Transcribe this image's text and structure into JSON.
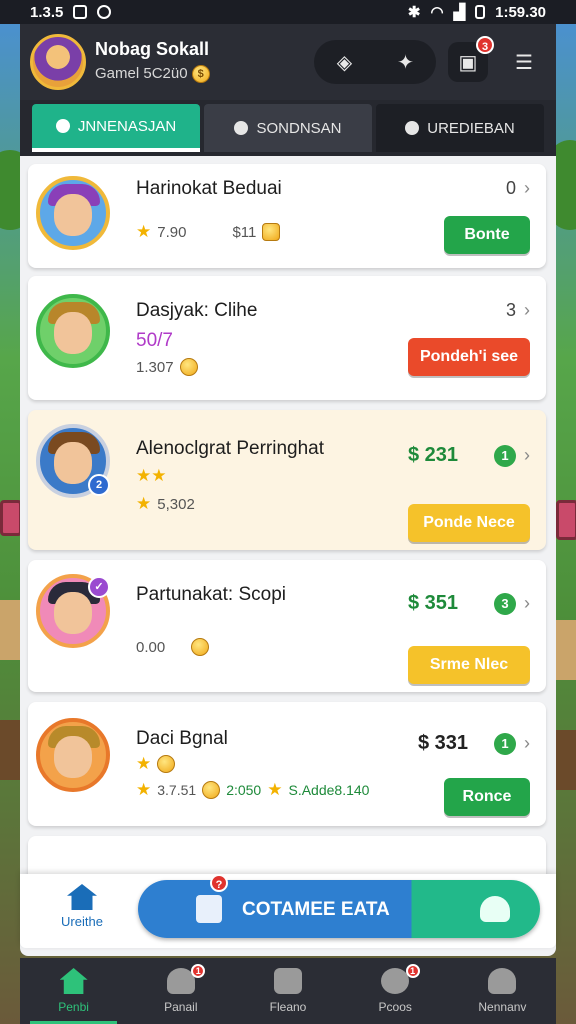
{
  "status_bar": {
    "time_left": "1.3.5",
    "time_right": "1:59.30"
  },
  "header": {
    "player_name": "Nobag Sokall",
    "player_sub": "Gamel 5C2ü0",
    "buttons": [
      "chat-icon",
      "settings-icon",
      "inbox-icon",
      "menu-icon"
    ],
    "inbox_badge": "3"
  },
  "tabs": [
    {
      "label": "JNNENASJAN",
      "icon": "person-icon",
      "active": true
    },
    {
      "label": "SONDNSAN",
      "icon": "person-icon",
      "active": false
    },
    {
      "label": "UREDIEBAN",
      "icon": "group-icon",
      "active": false
    }
  ],
  "cards": [
    {
      "name": "Harinokat Beduai",
      "stat1": "7.90",
      "stat2": "$11",
      "side": "0",
      "button": "Bonte",
      "button_color": "green"
    },
    {
      "name": "Dasjyak: Clihe",
      "level": "50/7",
      "stat1": "1.307",
      "side": "3",
      "button": "Pondeh'i see",
      "button_color": "red"
    },
    {
      "name": "Alenoclgrat Perringhat",
      "stat1": "5,302",
      "money": "$ 231",
      "count": "1",
      "button": "Ponde Nece",
      "button_color": "yellow"
    },
    {
      "name": "Partunakat: Scopi",
      "stat1": "0.00",
      "money": "$ 351",
      "count": "3",
      "button": "Srme Nlec",
      "button_color": "yellow"
    },
    {
      "name": "Daci Bgnal",
      "stat1": "3.7.51",
      "stat2": "2:050",
      "stat3": "S.Adde8.140",
      "money": "$ 331",
      "count": "1",
      "button": "Ronce",
      "button_color": "green"
    }
  ],
  "action_bar": {
    "home_label": "Ureithe",
    "cta_label": "COTAMEE EATA",
    "cta_badge": "?"
  },
  "bottom_nav": [
    {
      "label": "Penbi",
      "active": true,
      "badge": ""
    },
    {
      "label": "Panail",
      "active": false,
      "badge": "1"
    },
    {
      "label": "Fleano",
      "active": false,
      "badge": ""
    },
    {
      "label": "Pcoos",
      "active": false,
      "badge": "1"
    },
    {
      "label": "Nennanv",
      "active": false,
      "badge": ""
    }
  ],
  "colors": {
    "accent": "#1fb38a",
    "primary_blue": "#2e7fd0",
    "green": "#23a54a",
    "red": "#ea4a2a",
    "yellow": "#f5c22a"
  }
}
